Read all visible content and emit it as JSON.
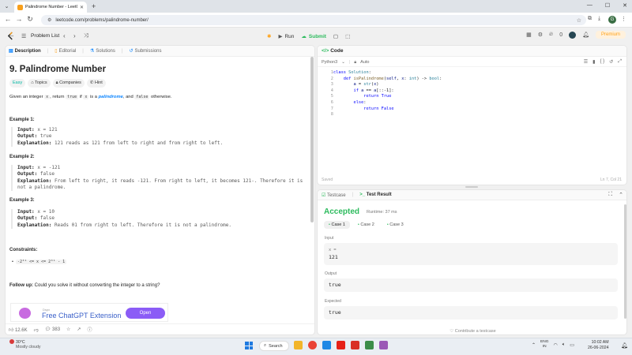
{
  "browser": {
    "tab_title": "Palindrome Number - LeetCo...",
    "url": "leetcode.com/problems/palindrome-number/",
    "profile_initial": "G"
  },
  "nav": {
    "problem_list": "Problem List",
    "run": "Run",
    "submit": "Submit",
    "streak": "0",
    "premium": "Premium"
  },
  "left_tabs": [
    "Description",
    "Editorial",
    "Solutions",
    "Submissions"
  ],
  "problem": {
    "title": "9. Palindrome Number",
    "difficulty": "Easy",
    "chips": [
      "Topics",
      "Companies",
      "Hint"
    ],
    "desc_1": "Given an integer ",
    "desc_x": "x",
    "desc_2": ", return ",
    "desc_true": "true",
    "desc_3": " if ",
    "desc_x2": "x",
    "desc_4": " is a ",
    "desc_pal": "palindrome",
    "desc_5": ", and ",
    "desc_false": "false",
    "desc_6": " otherwise.",
    "examples": [
      {
        "heading": "Example 1:",
        "input": "x = 121",
        "output": "true",
        "explanation": "121 reads as 121 from left to right and from right to left."
      },
      {
        "heading": "Example 2:",
        "input": "x = -121",
        "output": "false",
        "explanation": "From left to right, it reads -121. From right to left, it becomes 121-. Therefore it is not a palindrome."
      },
      {
        "heading": "Example 3:",
        "input": "x = 10",
        "output": "false",
        "explanation": "Reads 01 from right to left. Therefore it is not a palindrome."
      }
    ],
    "labels": {
      "input": "Input:",
      "output": "Output:",
      "explanation": "Explanation:"
    },
    "constraints_heading": "Constraints:",
    "constraint": "-2³¹ <= x <= 2³¹ - 1",
    "followup_label": "Follow up:",
    "followup_text": " Could you solve it without converting the integer to a string?"
  },
  "ad": {
    "source": "Dspx",
    "name": "Free ChatGPT Extension",
    "cta": "Open"
  },
  "left_footer": {
    "likes": "12.6K",
    "comments": "383"
  },
  "code_panel": {
    "tab": "Code",
    "language": "Python3",
    "mode": "Auto",
    "lines": [
      "class Solution:",
      "    def isPalindrome(self, x: int) -> bool:",
      "        a = str(x)",
      "        if a == a[::-1]:",
      "            return True",
      "        else:",
      "            return False",
      ""
    ],
    "saved": "Saved",
    "cursor": "Ln 7, Col 21"
  },
  "result_panel": {
    "tabs": [
      "Testcase",
      "Test Result"
    ],
    "status": "Accepted",
    "runtime": "Runtime: 37 ms",
    "cases": [
      "Case 1",
      "Case 2",
      "Case 3"
    ],
    "input_label": "Input",
    "input_var": "x =",
    "input_value": "121",
    "output_label": "Output",
    "output_value": "true",
    "expected_label": "Expected",
    "expected_value": "true",
    "contribute": "Contribute a testcase"
  },
  "taskbar": {
    "temp": "30°C",
    "condition": "Mostly cloudy",
    "search": "Search",
    "lang1": "ENG",
    "lang2": "IN",
    "time": "10:02 AM",
    "date": "26-06-2024"
  },
  "colors": {
    "accepted": "#2cbb5d",
    "premium": "#ffa116",
    "easy": "#00b8a3"
  }
}
